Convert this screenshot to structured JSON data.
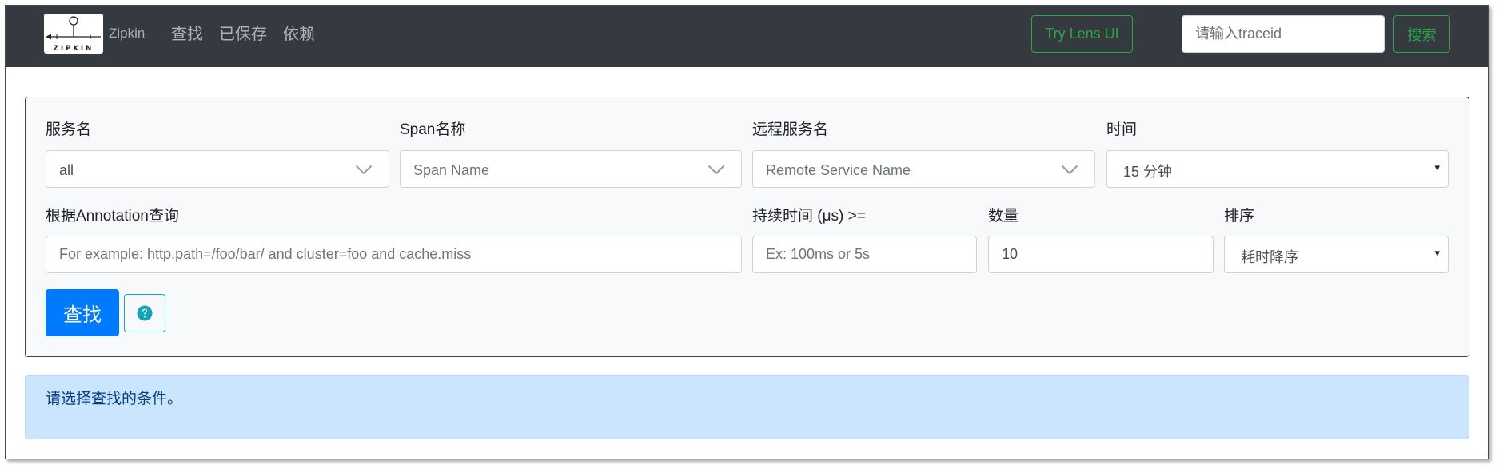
{
  "navbar": {
    "logo_text": "ZIPKIN",
    "brand": "Zipkin",
    "links": [
      "查找",
      "已保存",
      "依赖"
    ],
    "lens_button": "Try Lens UI",
    "traceid_placeholder": "请输入traceid",
    "search_button": "搜索"
  },
  "search_form": {
    "service": {
      "label": "服务名",
      "value": "all"
    },
    "span": {
      "label": "Span名称",
      "placeholder": "Span Name"
    },
    "remote_service": {
      "label": "远程服务名",
      "placeholder": "Remote Service Name"
    },
    "time": {
      "label": "时间",
      "value": "15 分钟"
    },
    "annotation": {
      "label": "根据Annotation查询",
      "placeholder": "For example: http.path=/foo/bar/ and cluster=foo and cache.miss"
    },
    "duration": {
      "label": "持续时间 (μs) >=",
      "placeholder": "Ex: 100ms or 5s"
    },
    "limit": {
      "label": "数量",
      "value": "10"
    },
    "sort": {
      "label": "排序",
      "value": "耗时降序"
    },
    "find_button": "查找",
    "caret": "▾"
  },
  "alert": {
    "message": "请选择查找的条件。"
  },
  "icons": {
    "logo": "zipkin-logo-icon",
    "select_dropdown": "chevron-down-icon",
    "native_select": "caret-down-icon",
    "help": "question-circle-icon"
  },
  "colors": {
    "navbar_bg": "#343a40",
    "success": "#28a745",
    "primary": "#007bff",
    "info": "#17a2b8",
    "panel_bg": "#f8f9fa",
    "alert_bg": "#cce5ff",
    "alert_border": "#b8daff",
    "alert_text": "#004085"
  }
}
